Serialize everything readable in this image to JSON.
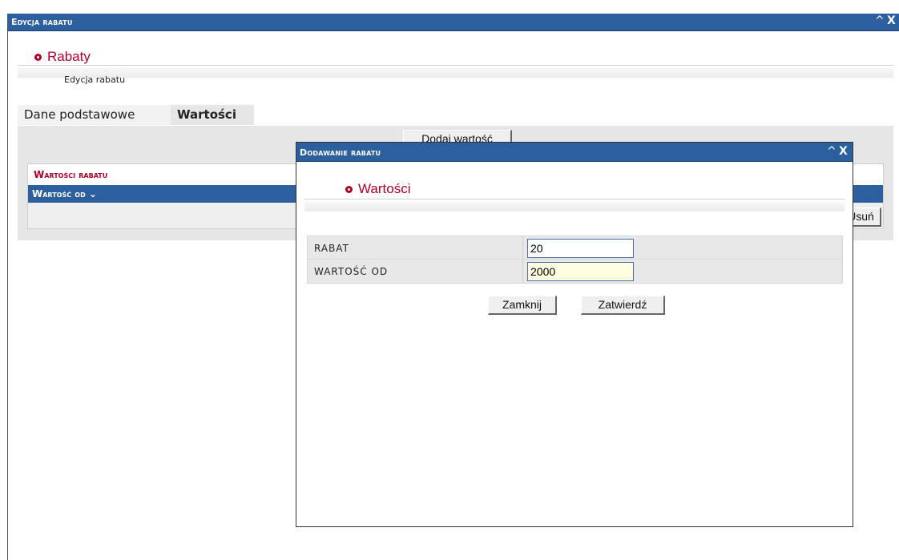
{
  "window": {
    "title": "Edycja rabatu",
    "min_icon": "^",
    "close_icon": "X"
  },
  "page": {
    "section_title": "Rabaty",
    "subtitle": "Edycja rabatu"
  },
  "tabs": [
    {
      "label": "Dane podstawowe",
      "active": false
    },
    {
      "label": "Wartości",
      "active": true
    }
  ],
  "toolbar": {
    "add_button_label": "Dodaj wartość"
  },
  "grid": {
    "caption": "Wartości rabatu",
    "column_header": "Wartość od ⌄",
    "delete_button_label": "Usuń"
  },
  "modal": {
    "title": "Dodawanie rabatu",
    "min_icon": "^",
    "close_icon": "X",
    "section_title": "Wartości",
    "fields": [
      {
        "label": "RABAT",
        "value": "20"
      },
      {
        "label": "WARTOŚĆ OD",
        "value": "2000"
      }
    ],
    "close_button_label": "Zamknij",
    "confirm_button_label": "Zatwierdź"
  },
  "colors": {
    "titlebar": "#2c5f9e",
    "accent_red": "#b0002a"
  }
}
